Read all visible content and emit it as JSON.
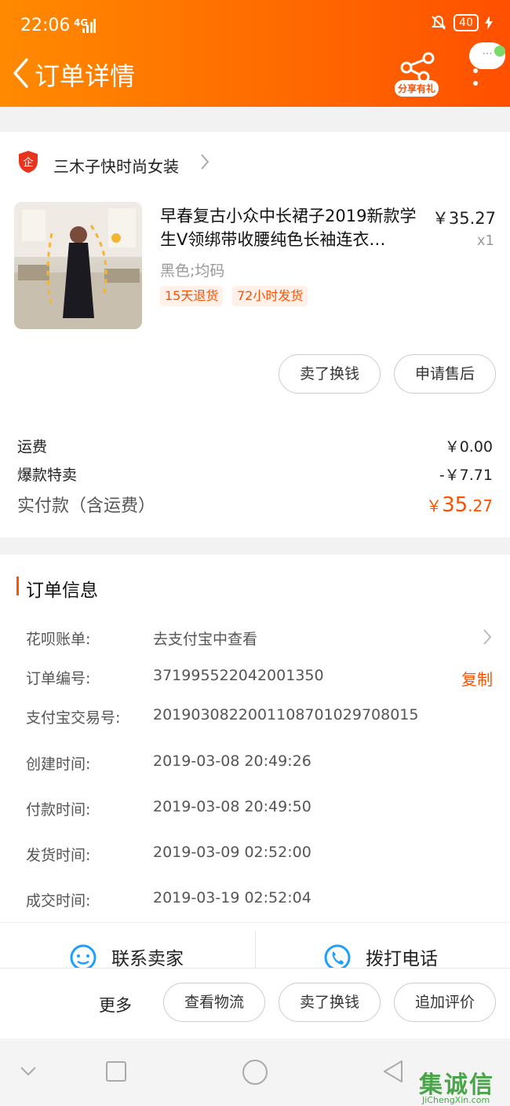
{
  "status_bar": {
    "time": "22:06",
    "network": "4G",
    "battery": "40"
  },
  "header": {
    "title": "订单详情",
    "share_label": "分享有礼",
    "bubble": "···"
  },
  "shop": {
    "name": "三木子快时尚女装"
  },
  "product": {
    "title": "早春复古小众中长裙子2019新款学生V领绑带收腰纯色长袖连衣…",
    "price": "￥35.27",
    "quantity": "x1",
    "spec": "黑色;均码",
    "tags": [
      "15天退货",
      "72小时发货"
    ]
  },
  "product_actions": {
    "sell_label": "卖了换钱",
    "after_sale_label": "申请售后"
  },
  "fees": {
    "shipping_label": "运费",
    "shipping_value": "￥0.00",
    "discount_label": "爆款特卖",
    "discount_value": "-￥7.71",
    "total_label": "实付款（含运费）",
    "total_symbol": "￥",
    "total_int": "35",
    "total_dec": ".27"
  },
  "order_info": {
    "title": "订单信息",
    "rows": [
      {
        "label": "花呗账单:",
        "value": "去支付宝中查看"
      },
      {
        "label": "订单编号:",
        "value": "371995522042001350",
        "action": "复制"
      },
      {
        "label": "支付宝交易号:",
        "value": "2019030822001108701029708015"
      },
      {
        "label": "创建时间:",
        "value": "2019-03-08 20:49:26"
      },
      {
        "label": "付款时间:",
        "value": "2019-03-08 20:49:50"
      },
      {
        "label": "发货时间:",
        "value": "2019-03-09 02:52:00"
      },
      {
        "label": "成交时间:",
        "value": "2019-03-19 02:52:04"
      }
    ]
  },
  "contact": {
    "seller_label": "联系卖家",
    "phone_label": "拨打电话"
  },
  "action_bar": {
    "more_label": "更多",
    "logistics_label": "查看物流",
    "sell_label": "卖了换钱",
    "review_label": "追加评价"
  },
  "watermark": {
    "text": "集诚信",
    "sub": "JiChengXin.com"
  },
  "colors": {
    "accent": "#ff5000",
    "header_start": "#ff8a00",
    "header_end": "#ff5000",
    "contact_icon": "#1ea0ff"
  }
}
